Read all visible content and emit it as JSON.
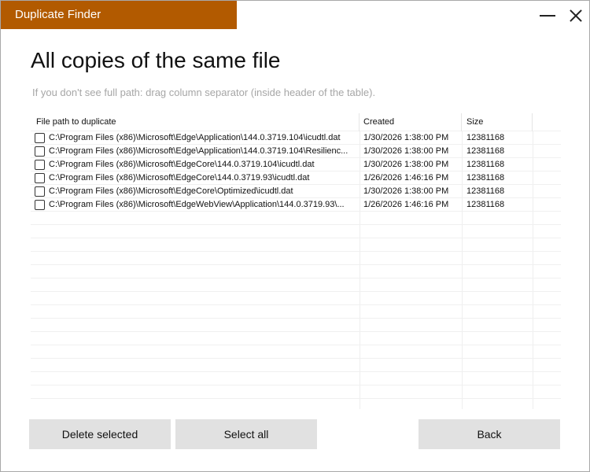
{
  "window": {
    "title": "Duplicate Finder",
    "accent": "#b25a00"
  },
  "page": {
    "heading": "All copies of the same file",
    "hint": "If you don't see full path: drag column separator (inside header of the table)."
  },
  "table": {
    "columns": {
      "path": "File path to duplicate",
      "created": "Created",
      "size": "Size"
    },
    "rows": [
      {
        "checked": false,
        "path": "C:\\Program Files (x86)\\Microsoft\\Edge\\Application\\144.0.3719.104\\icudtl.dat",
        "created": "1/30/2026 1:38:00 PM",
        "size": "12381168"
      },
      {
        "checked": false,
        "path": "C:\\Program Files (x86)\\Microsoft\\Edge\\Application\\144.0.3719.104\\Resilienc...",
        "created": "1/30/2026 1:38:00 PM",
        "size": "12381168"
      },
      {
        "checked": false,
        "path": "C:\\Program Files (x86)\\Microsoft\\EdgeCore\\144.0.3719.104\\icudtl.dat",
        "created": "1/30/2026 1:38:00 PM",
        "size": "12381168"
      },
      {
        "checked": false,
        "path": "C:\\Program Files (x86)\\Microsoft\\EdgeCore\\144.0.3719.93\\icudtl.dat",
        "created": "1/26/2026 1:46:16 PM",
        "size": "12381168"
      },
      {
        "checked": false,
        "path": "C:\\Program Files (x86)\\Microsoft\\EdgeCore\\Optimized\\icudtl.dat",
        "created": "1/30/2026 1:38:00 PM",
        "size": "12381168"
      },
      {
        "checked": false,
        "path": "C:\\Program Files (x86)\\Microsoft\\EdgeWebView\\Application\\144.0.3719.93\\...",
        "created": "1/26/2026 1:46:16 PM",
        "size": "12381168"
      }
    ]
  },
  "buttons": {
    "delete_selected": "Delete selected",
    "select_all": "Select all",
    "back": "Back"
  }
}
